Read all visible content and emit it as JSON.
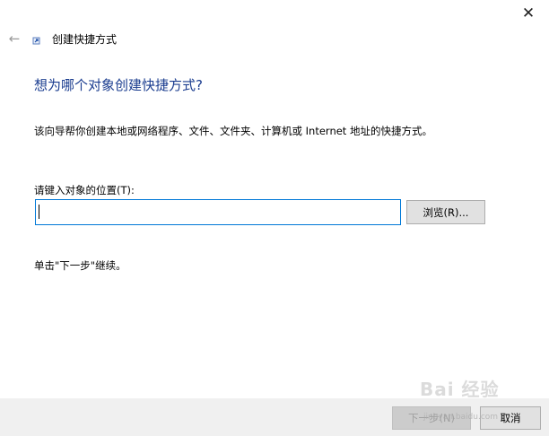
{
  "window": {
    "close_glyph": "✕",
    "back_glyph": "←",
    "title": "创建快捷方式"
  },
  "content": {
    "heading": "想为哪个对象创建快捷方式?",
    "description": "该向导帮你创建本地或网络程序、文件、文件夹、计算机或 Internet 地址的快捷方式。",
    "field_label": "请键入对象的位置(T):",
    "location_value": "",
    "browse_label": "浏览(R)...",
    "hint": "单击\"下一步\"继续。"
  },
  "footer": {
    "next_label": "下一步(N)",
    "cancel_label": "取消"
  },
  "watermark": {
    "text": "Bai 经验",
    "sub": "jingyan.baidu.com"
  },
  "colors": {
    "heading": "#1a3c8f",
    "input_border": "#0078d7",
    "footer_bg": "#f0f0f0",
    "button_bg": "#e1e1e1"
  },
  "icons": {
    "wizard": "shortcut-wizard-icon",
    "back": "back-arrow-icon",
    "close": "close-icon"
  }
}
